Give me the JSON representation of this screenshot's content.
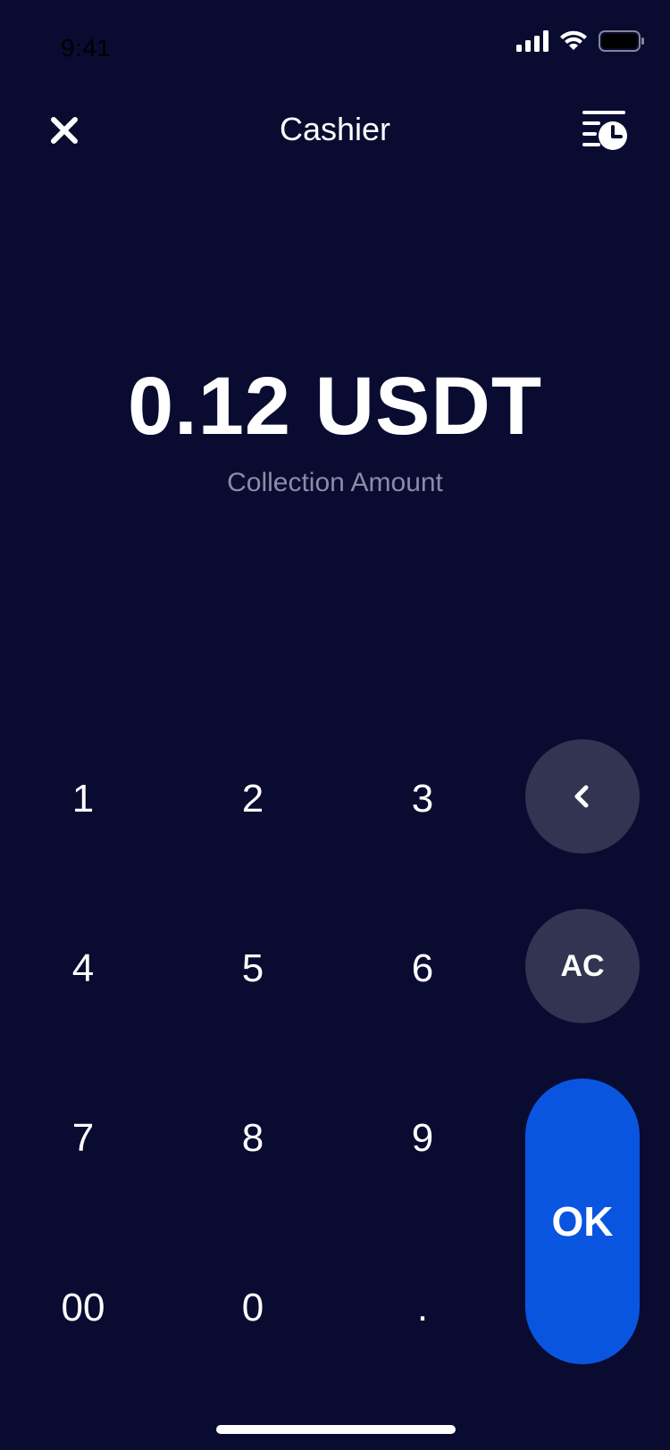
{
  "status_bar": {
    "time": "9:41"
  },
  "nav": {
    "title": "Cashier",
    "close_icon": "close-icon",
    "history_icon": "history-clock-icon"
  },
  "amount": {
    "value": "0.12 USDT",
    "label": "Collection Amount"
  },
  "keypad": {
    "keys": [
      "1",
      "2",
      "3",
      "4",
      "5",
      "6",
      "7",
      "8",
      "9",
      "00",
      "0",
      "."
    ]
  },
  "actions": {
    "backspace_icon": "chevron-left-icon",
    "clear_label": "AC",
    "confirm_label": "OK"
  },
  "colors": {
    "background": "#090b31",
    "secondary_button": "#323451",
    "primary_button": "#0a55df",
    "muted_text": "#8a8da6"
  }
}
